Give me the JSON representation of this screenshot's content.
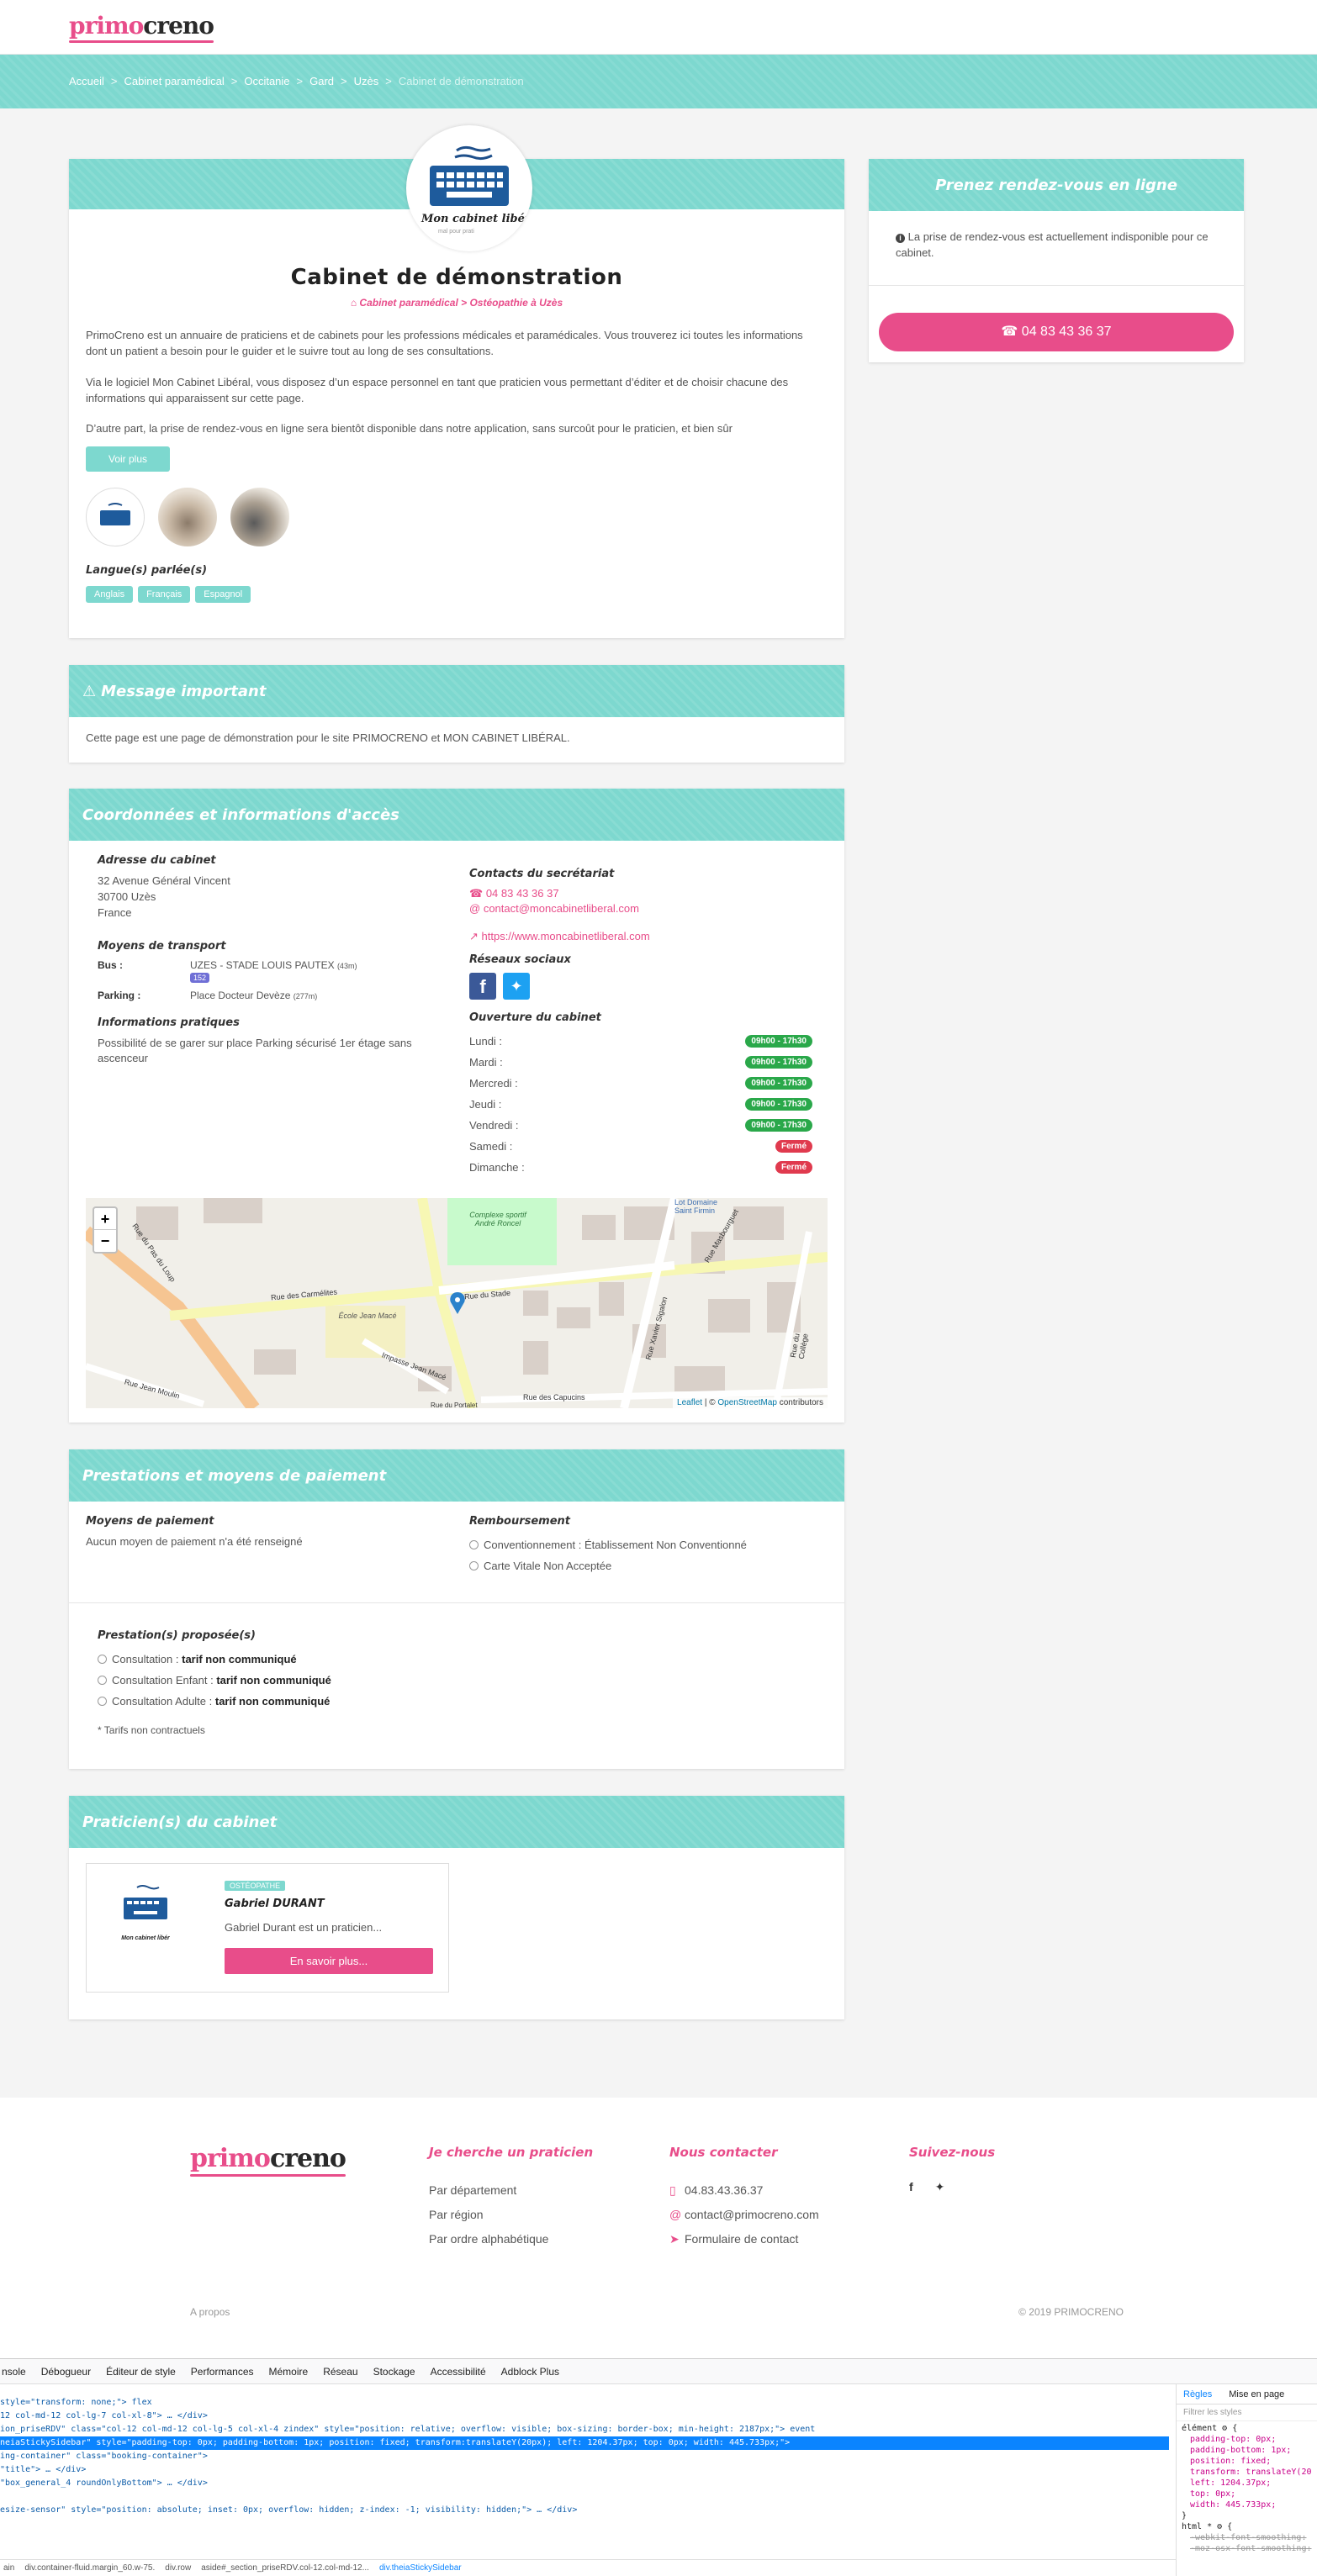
{
  "header": {
    "logo_a": "primo",
    "logo_b": "creno"
  },
  "breadcrumb": [
    "Accueil",
    "Cabinet paramédical",
    "Occitanie",
    "Gard",
    "Uzès",
    "Cabinet de démonstration"
  ],
  "cabinet": {
    "title": "Cabinet de démonstration",
    "subtitle": "Cabinet paramédical > Ostéopathie à Uzès",
    "p1": "PrimoCreno est un annuaire de praticiens et de cabinets pour les professions médicales et paramédicales. Vous trouverez ici toutes les informations dont un patient a besoin pour le guider et le suivre tout au long de ses consultations.",
    "p2": "Via le logiciel Mon Cabinet Libéral, vous disposez d’un espace personnel en tant que praticien vous permettant d’éditer et de choisir chacune des informations qui apparaissent sur cette page.",
    "p3": "D’autre part, la prise de rendez-vous en ligne sera bientôt disponible dans notre application, sans surcoût pour le praticien, et bien sûr",
    "more": "Voir plus",
    "logo_text": "Mon cabinet libér",
    "logo_sub": "mal pour prati",
    "langs_title": "Langue(s) parlée(s)",
    "langs": [
      "Anglais",
      "Français",
      "Espagnol"
    ]
  },
  "message": {
    "title": "Message important",
    "text": "Cette page est une page de démonstration pour le site PRIMOCRENO et MON CABINET LIBÉRAL."
  },
  "coords": {
    "title": "Coordonnées et informations d'accès",
    "addr_title": "Adresse du cabinet",
    "addr": [
      "32 Avenue Général Vincent",
      "30700 Uzès",
      "France"
    ],
    "transport_title": "Moyens de transport",
    "bus_label": "Bus :",
    "bus_value": "UZES - STADE LOUIS PAUTEX",
    "bus_dist": "(43m)",
    "bus_line": "152",
    "parking_label": "Parking :",
    "parking_value": "Place Docteur Devèze",
    "parking_dist": "(277m)",
    "info_title": "Informations pratiques",
    "info": "Possibilité de se garer sur place Parking sécurisé 1er étage sans ascenceur",
    "contacts_title": "Contacts du secrétariat",
    "phone": "04 83 43 36 37",
    "email": "contact@moncabinetliberal.com",
    "web": "https://www.moncabinetliberal.com",
    "social_title": "Réseaux sociaux",
    "hours_title": "Ouverture du cabinet",
    "hours": [
      {
        "day": "Lundi :",
        "val": "09h00 - 17h30",
        "open": true
      },
      {
        "day": "Mardi :",
        "val": "09h00 - 17h30",
        "open": true
      },
      {
        "day": "Mercredi :",
        "val": "09h00 - 17h30",
        "open": true
      },
      {
        "day": "Jeudi :",
        "val": "09h00 - 17h30",
        "open": true
      },
      {
        "day": "Vendredi :",
        "val": "09h00 - 17h30",
        "open": true
      },
      {
        "day": "Samedi :",
        "val": "Fermé",
        "open": false
      },
      {
        "day": "Dimanche :",
        "val": "Fermé",
        "open": false
      }
    ],
    "map": {
      "streets": [
        "Rue du Stade",
        "Rue des Carmélites",
        "Impasse Jean Macé",
        "Rue des Capucins",
        "Rue Jean Moulin",
        "Rue Xavier Sigalon",
        "Rue du Portalet",
        "Rue Masbourguet",
        "Rue du Pas du Loup",
        "Rue du Collège"
      ],
      "places": [
        "Complexe sportif André Roncel",
        "École Jean Macé",
        "Lot Domaine Saint Firmin"
      ],
      "attrib_a": "Leaflet",
      "attrib_sep": " | © ",
      "attrib_b": "OpenStreetMap",
      "attrib_c": " contributors",
      "zoom_in": "+",
      "zoom_out": "−"
    }
  },
  "prestations": {
    "title": "Prestations et moyens de paiement",
    "pay_title": "Moyens de paiement",
    "pay_text": "Aucun moyen de paiement n'a été renseigné",
    "remb_title": "Remboursement",
    "remb": [
      "Conventionnement : Établissement Non Conventionné",
      "Carte Vitale Non Acceptée"
    ],
    "prest_title": "Prestation(s) proposée(s)",
    "items": [
      {
        "name": "Consultation : ",
        "price": "tarif non communiqué"
      },
      {
        "name": "Consultation Enfant : ",
        "price": "tarif non communiqué"
      },
      {
        "name": "Consultation Adulte : ",
        "price": "tarif non communiqué"
      }
    ],
    "note": "* Tarifs non contractuels"
  },
  "praticiens": {
    "title": "Praticien(s) du cabinet",
    "tag": "OSTÉOPATHE",
    "name": "Gabriel DURANT",
    "desc": "Gabriel Durant est un praticien...",
    "btn": "En savoir plus..."
  },
  "sidebar": {
    "title": "Prenez rendez-vous en ligne",
    "notice": "La prise de rendez-vous est actuellement indisponible pour ce cabinet.",
    "phone": "04 83 43 36 37"
  },
  "footer": {
    "c1": "Je cherche un praticien",
    "links1": [
      "Par département",
      "Par région",
      "Par ordre alphabétique"
    ],
    "c2": "Nous contacter",
    "phone": "04.83.43.36.37",
    "email": "contact@primocreno.com",
    "form": "Formulaire de contact",
    "c3": "Suivez-nous",
    "about": "A propos",
    "copy": "© 2019 PRIMOCRENO"
  },
  "devtools": {
    "tabs": [
      "nsole",
      "Débogueur",
      "Éditeur de style",
      "Performances",
      "Mémoire",
      "Réseau",
      "Stockage",
      "Accessibilité",
      "Adblock Plus"
    ],
    "right_tabs": [
      "Règles",
      "Mise en page"
    ],
    "filter": "Filtrer les styles",
    "lines": [
      "style=\"transform: none;\"> flex",
      "12 col-md-12 col-lg-7 col-xl-8\"> … </div>",
      "ion_priseRDV\" class=\"col-12 col-md-12 col-lg-5 col-xl-4 zindex\" style=\"position: relative; overflow: visible; box-sizing: border-box; min-height: 2187px;\"> event",
      "neiaStickySidebar\" style=\"padding-top: 0px; padding-bottom: 1px; position: fixed; transform:translateY(20px); left: 1204.37px; top: 0px; width: 445.733px;\">",
      "ing-container\" class=\"booking-container\">",
      "\"title\"> … </div>",
      "\"box_general_4 roundOnlyBottom\"> … </div>",
      "",
      "esize-sensor\" style=\"position: absolute; inset: 0px; overflow: hidden; z-index: -1; visibility: hidden;\"> … </div>"
    ],
    "rules": [
      "élément ⚙ {",
      "padding-top: 0px;",
      "padding-bottom: 1px;",
      "position: fixed;",
      "transform: translateY(20px);",
      "left: 1204.37px;",
      "top: 0px;",
      "width: 445.733px;",
      "}",
      "html * ⚙ {",
      "-webkit-font-smoothing:",
      "-moz-osx-font-smoothing:"
    ],
    "path": [
      "ain",
      "div.container-fluid.margin_60.w-75.",
      "div.row",
      "aside#_section_priseRDV.col-12.col-md-12...",
      "div.theiaStickySidebar"
    ]
  }
}
